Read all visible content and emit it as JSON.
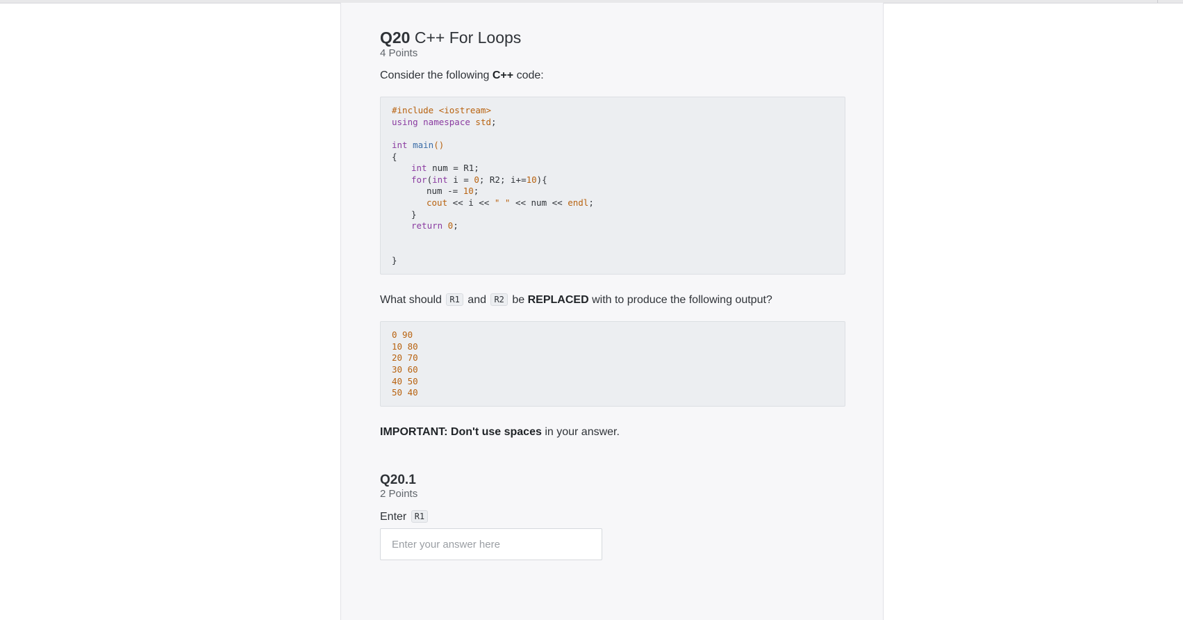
{
  "question": {
    "number": "Q20",
    "title": "C++ For Loops",
    "points": "4 Points",
    "intro_prefix": "Consider the following",
    "intro_lang": "C++",
    "intro_suffix": "code:"
  },
  "code": {
    "l01": "#include <iostream>",
    "l02_kw": "using namespace",
    "l02_rest": " std",
    "l02_end": ";",
    "l03_kw": "int",
    "l03_fn": " main",
    "l03_paren": "()",
    "l04": "{",
    "l05_kw": "int",
    "l05_rest": " num = R1;",
    "l06_kw": "for",
    "l06_a": "(",
    "l06_kw2": "int",
    "l06_b": " i = ",
    "l06_c": "0",
    "l06_d": "; R2; i+=",
    "l06_e": "10",
    "l06_f": "){",
    "l07_a": "num -= ",
    "l07_b": "10",
    "l07_c": ";",
    "l08_a": "cout",
    "l08_b": " << i << ",
    "l08_c": "\" \"",
    "l08_d": " << num << ",
    "l08_e": "endl",
    "l08_f": ";",
    "l09": "}",
    "l10_kw": "return",
    "l10_b": " 0",
    "l10_c": ";",
    "l11": "}"
  },
  "question_text": {
    "prefix": "What should",
    "r1": "R1",
    "and": "and",
    "r2": "R2",
    "be": "be",
    "replaced": "REPLACED",
    "suffix": "with to produce the following output?"
  },
  "output_lines": [
    "0 90",
    "10 80",
    "20 70",
    "30 60",
    "40 50",
    "50 40"
  ],
  "important": {
    "label": "IMPORTANT: Don't use spaces",
    "rest": "in your answer."
  },
  "subquestion": {
    "number": "Q20.1",
    "points": "2 Points",
    "prompt": "Enter",
    "code": "R1",
    "input_value": "",
    "input_placeholder": "Enter your answer here"
  },
  "colors": {
    "page_bg": "#ffffff",
    "panel_bg": "#f7f7f9",
    "code_bg": "#eceef1",
    "keyword": "#8a3ba0",
    "function": "#3b6da8",
    "literal": "#b8620f"
  }
}
